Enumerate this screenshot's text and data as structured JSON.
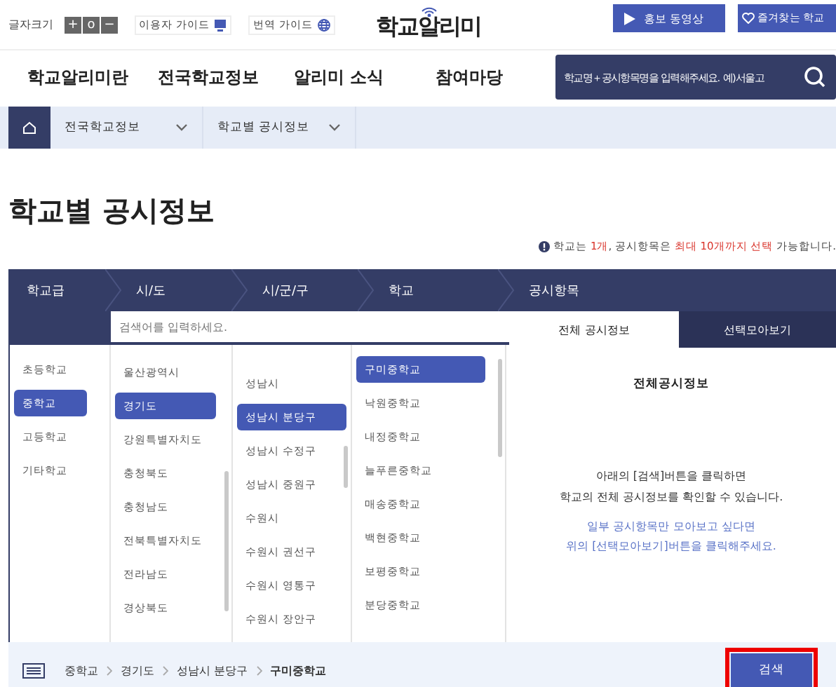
{
  "header": {
    "font_size_label": "글자크기",
    "font_size_buttons": [
      "+",
      "o",
      "−"
    ],
    "user_guide": "이용자 가이드",
    "translation_guide": "번역 가이드",
    "logo": "학교알리미",
    "promo_button": "홍보 동영상",
    "favorites_button": "즐겨찾는 학교"
  },
  "nav": {
    "items": [
      "학교알리미란",
      "전국학교정보",
      "알리미 소식",
      "참여마당"
    ],
    "search": {
      "placeholder": "학교명＋공시항목명을 입력해주세요. 예)서울고"
    }
  },
  "breadcrumb": {
    "items": [
      "전국학교정보",
      "학교별 공시정보"
    ]
  },
  "page_title": "학교별 공시정보",
  "notice": "학교는 **1개**, 공시항목은 **최대 10개까지 선택** 가능합니다.",
  "steps": [
    "학교급",
    "시/도",
    "시/군/구",
    "학교",
    "공시항목"
  ],
  "search": {
    "placeholder": "검색어를 입력하세요."
  },
  "tabs": [
    {
      "label": "전체 공시정보",
      "selected": true
    },
    {
      "label": "선택모아보기",
      "selected": false
    }
  ],
  "columns": [
    {
      "items": [
        {
          "label": "초등학교",
          "selected": false
        },
        {
          "label": "중학교",
          "selected": true
        },
        {
          "label": "고등학교",
          "selected": false
        },
        {
          "label": "기타학교",
          "selected": false
        }
      ]
    },
    {
      "items": [
        {
          "label": "울산광역시",
          "selected": false
        },
        {
          "label": "경기도",
          "selected": true
        },
        {
          "label": "강원특별자치도",
          "selected": false
        },
        {
          "label": "충청북도",
          "selected": false
        },
        {
          "label": "충청남도",
          "selected": false
        },
        {
          "label": "전북특별자치도",
          "selected": false
        },
        {
          "label": "전라남도",
          "selected": false
        },
        {
          "label": "경상북도",
          "selected": false
        }
      ]
    },
    {
      "items": [
        {
          "label": "성남시",
          "selected": false
        },
        {
          "label": "성남시 분당구",
          "selected": true
        },
        {
          "label": "성남시 수정구",
          "selected": false
        },
        {
          "label": "성남시 중원구",
          "selected": false
        },
        {
          "label": "수원시",
          "selected": false
        },
        {
          "label": "수원시 권선구",
          "selected": false
        },
        {
          "label": "수원시 영통구",
          "selected": false
        },
        {
          "label": "수원시 장안구",
          "selected": false
        }
      ]
    },
    {
      "items": [
        {
          "label": "구미중학교",
          "selected": true
        },
        {
          "label": "낙원중학교",
          "selected": false
        },
        {
          "label": "내정중학교",
          "selected": false
        },
        {
          "label": "늘푸른중학교",
          "selected": false
        },
        {
          "label": "매송중학교",
          "selected": false
        },
        {
          "label": "백현중학교",
          "selected": false
        },
        {
          "label": "보평중학교",
          "selected": false
        },
        {
          "label": "분당중학교",
          "selected": false
        }
      ]
    }
  ],
  "panel": {
    "title": "전체공시정보",
    "message": [
      "아래의 [검색]버튼을 클릭하면",
      "학교의 전체 공시정보를 확인할 수 있습니다."
    ],
    "hint": [
      "일부 공시항목만 모아보고 싶다면",
      "위의 [선택모아보기]버튼을 클릭해주세요."
    ]
  },
  "selection_path": [
    "중학교",
    "경기도",
    "성남시 분당구",
    "구미중학교"
  ],
  "search_button": "검색"
}
